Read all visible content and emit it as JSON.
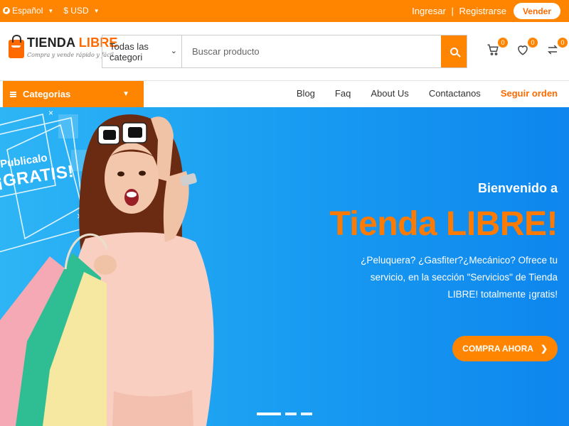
{
  "topbar": {
    "language": "Español",
    "currency": "$ USD",
    "login": "Ingresar",
    "separator": "|",
    "register": "Registrarse",
    "sell": "Vender"
  },
  "header": {
    "logo_word1": "TIENDA",
    "logo_word2": "LIBRE",
    "tagline": "Compra y vende rápido y fácil",
    "search_category": "Todas las categori",
    "search_placeholder": "Buscar producto",
    "cart_count": "0",
    "wishlist_count": "0",
    "compare_count": "0"
  },
  "nav": {
    "categories_label": "Categorias",
    "links": [
      "Blog",
      "Faq",
      "About Us",
      "Contactanos"
    ],
    "highlight": "Seguir orden"
  },
  "hero": {
    "promo_line1": "Publicalo",
    "promo_line2": "¡GRATIS!",
    "welcome": "Bienvenido a",
    "title": "Tienda LIBRE!",
    "description": "¿Peluquera? ¿Gasfiter?¿Mecánico? Ofrece tu servicio, en la sección \"Servicios\" de Tienda LIBRE! totalmente ¡gratis!",
    "cta": "COMPRA AHORA",
    "slide_count": 3,
    "active_slide": 1
  },
  "colors": {
    "accent": "#ff8400",
    "hero_blue": "#1a9ff2"
  }
}
